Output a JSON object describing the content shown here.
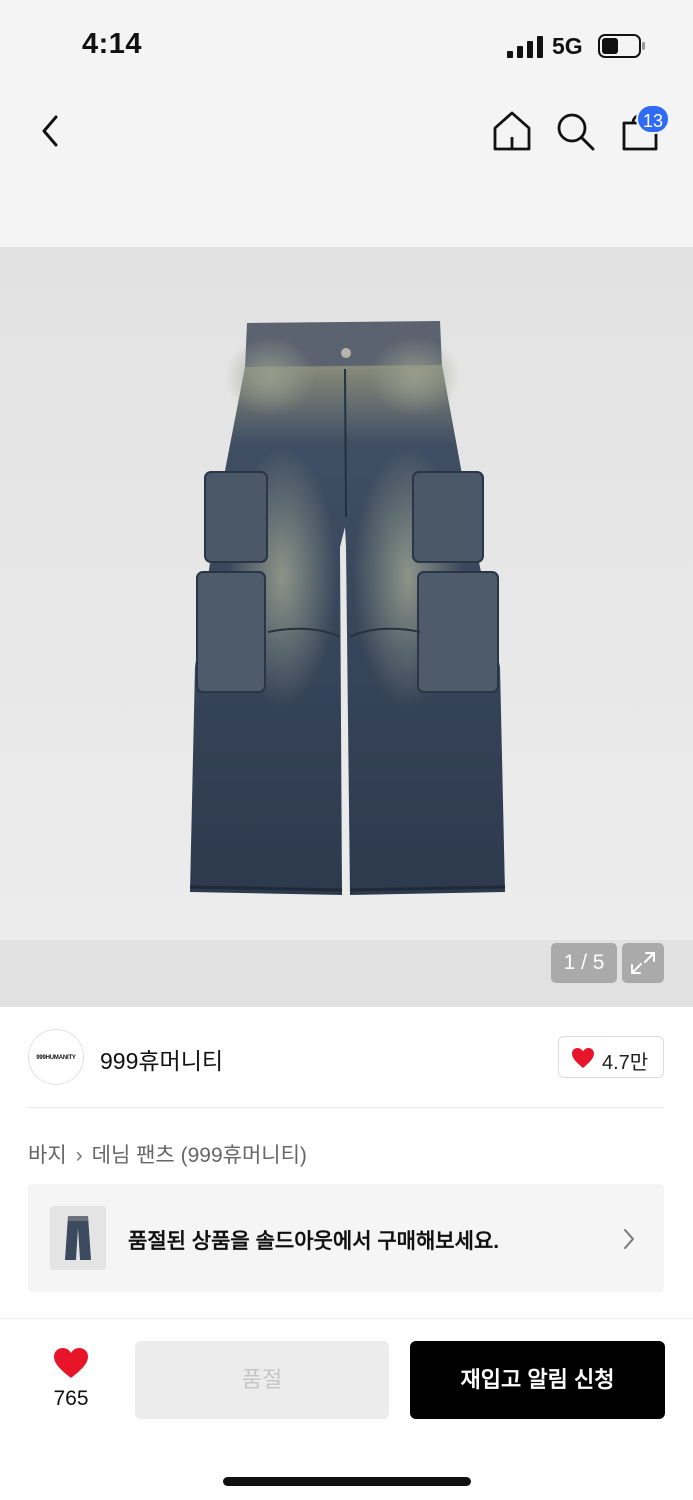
{
  "status_bar": {
    "time": "4:14",
    "network": "5G"
  },
  "nav": {
    "cart_count": "13"
  },
  "gallery": {
    "page_indicator": "1 / 5"
  },
  "brand": {
    "logo_text": "999HUMANITY",
    "name": "999휴머니티",
    "likes": "4.7만"
  },
  "breadcrumb": {
    "category": "바지",
    "subcategory": "데님 팬츠 (999휴머니티)"
  },
  "soldout_banner": {
    "text": "품절된 상품을 솔드아웃에서 구매해보세요."
  },
  "bottom": {
    "wish_count": "765",
    "soldout_label": "품절",
    "restock_label": "재입고 알림 신청"
  },
  "colors": {
    "accent_blue": "#2f6bf5",
    "heart_red": "#e8152a",
    "primary_black": "#000000"
  }
}
